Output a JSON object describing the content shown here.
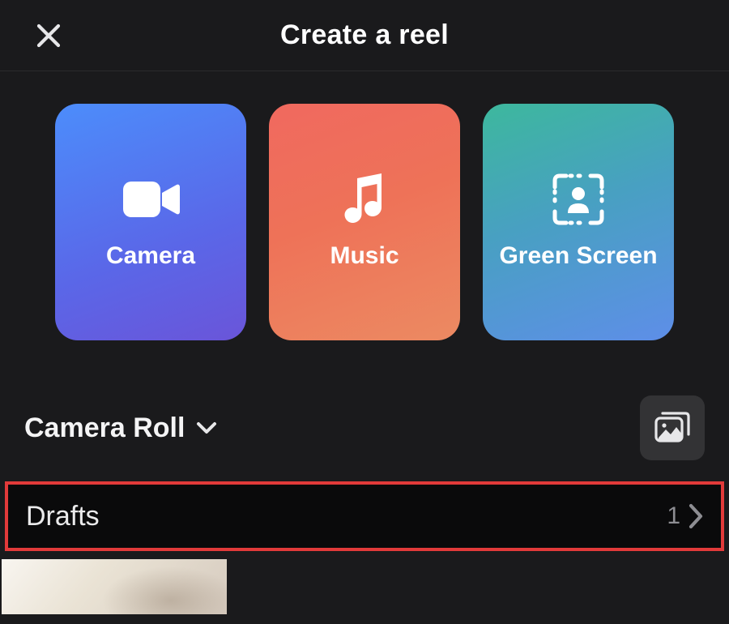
{
  "header": {
    "title": "Create a reel"
  },
  "cards": {
    "camera": {
      "label": "Camera"
    },
    "music": {
      "label": "Music"
    },
    "green_screen": {
      "label": "Green Screen"
    }
  },
  "source": {
    "label": "Camera Roll"
  },
  "drafts": {
    "label": "Drafts",
    "count": "1"
  }
}
